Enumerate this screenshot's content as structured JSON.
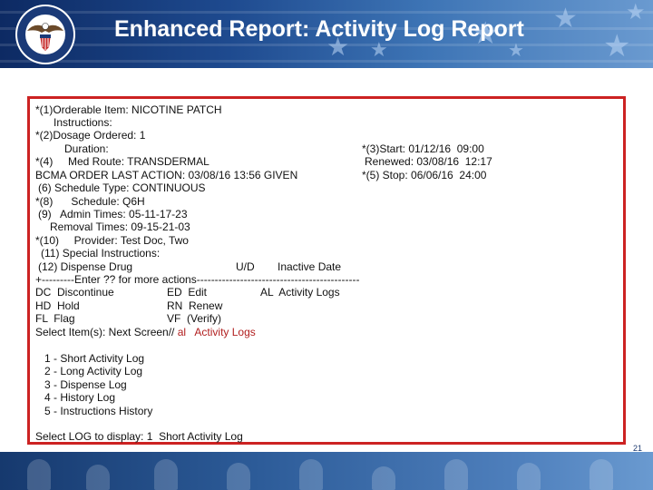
{
  "header": {
    "title": "Enhanced Report:  Activity Log Report",
    "seal_lettering": "DEPARTMENT OF VETERANS AFFAIRS • UNITED STATES OF AMERICA"
  },
  "colors": {
    "banner": "#1e4a8f",
    "panel_border": "#cc2222",
    "highlight_text": "#b11e1e"
  },
  "terminal": {
    "l1": "*(1)Orderable Item: NICOTINE PATCH",
    "l2": "Instructions:",
    "l3": "*(2)Dosage Ordered: 1",
    "l4": "Duration:",
    "l4b": "*(3)Start: 01/12/16  09:00",
    "l5": "*(4)     Med Route: TRANSDERMAL",
    "l5b": "Renewed: 03/08/16  12:17",
    "l6": "BCMA ORDER LAST ACTION: 03/08/16 13:56 GIVEN",
    "l6b": "*(5) Stop: 06/06/16  24:00",
    "l7": "(6) Schedule Type: CONTINUOUS",
    "l8": "*(8)      Schedule: Q6H",
    "l9": "(9)   Admin Times: 05-11-17-23",
    "l10": "Removal Times: 09-15-21-03",
    "l11": "*(10)     Provider: Test Doc, Two",
    "l12": "(11) Special Instructions:",
    "l13a": "(12) Dispense Drug",
    "l13b": "U/D",
    "l13c": "Inactive Date",
    "l14": "+---------Enter ?? for more actions---------------------------------------------",
    "a1": "DC  Discontinue",
    "a2": "ED  Edit",
    "a3": "AL  Activity Logs",
    "a4": "HD  Hold",
    "a5": "RN  Renew",
    "a6": "FL  Flag",
    "a7": "VF  (Verify)",
    "select_prefix": "Select Item(s): Next Screen// ",
    "select_value": "al   Activity Logs",
    "log_options": [
      "1 - Short Activity Log",
      "2 - Long Activity Log",
      "3 - Dispense Log",
      "4 - History Log",
      "5 - Instructions History"
    ],
    "log_prompt": "Select LOG to display: 1  Short Activity Log"
  },
  "page_number": "21"
}
